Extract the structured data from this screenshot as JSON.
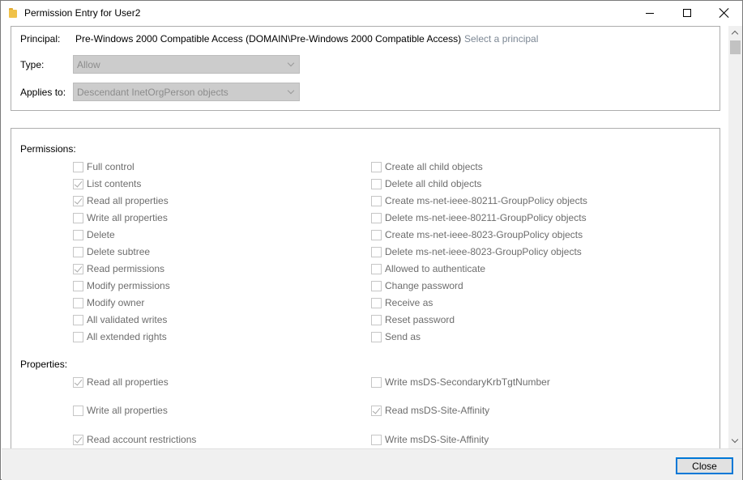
{
  "window": {
    "title": "Permission Entry for User2"
  },
  "principal": {
    "label": "Principal:",
    "value": "Pre-Windows 2000 Compatible Access (DOMAIN\\Pre-Windows 2000 Compatible Access)",
    "select_link": "Select a principal"
  },
  "type": {
    "label": "Type:",
    "value": "Allow"
  },
  "applies_to": {
    "label": "Applies to:",
    "value": "Descendant InetOrgPerson objects"
  },
  "permissions": {
    "title": "Permissions:",
    "left": [
      {
        "label": "Full control",
        "checked": false
      },
      {
        "label": "List contents",
        "checked": true
      },
      {
        "label": "Read all properties",
        "checked": true
      },
      {
        "label": "Write all properties",
        "checked": false
      },
      {
        "label": "Delete",
        "checked": false
      },
      {
        "label": "Delete subtree",
        "checked": false
      },
      {
        "label": "Read permissions",
        "checked": true
      },
      {
        "label": "Modify permissions",
        "checked": false
      },
      {
        "label": "Modify owner",
        "checked": false
      },
      {
        "label": "All validated writes",
        "checked": false
      },
      {
        "label": "All extended rights",
        "checked": false
      }
    ],
    "right": [
      {
        "label": "Create all child objects",
        "checked": false
      },
      {
        "label": "Delete all child objects",
        "checked": false
      },
      {
        "label": "Create ms-net-ieee-80211-GroupPolicy objects",
        "checked": false
      },
      {
        "label": "Delete ms-net-ieee-80211-GroupPolicy objects",
        "checked": false
      },
      {
        "label": "Create ms-net-ieee-8023-GroupPolicy objects",
        "checked": false
      },
      {
        "label": "Delete ms-net-ieee-8023-GroupPolicy objects",
        "checked": false
      },
      {
        "label": "Allowed to authenticate",
        "checked": false
      },
      {
        "label": "Change password",
        "checked": false
      },
      {
        "label": "Receive as",
        "checked": false
      },
      {
        "label": "Reset password",
        "checked": false
      },
      {
        "label": "Send as",
        "checked": false
      }
    ]
  },
  "properties": {
    "title": "Properties:",
    "left": [
      {
        "label": "Read all properties",
        "checked": true
      },
      {
        "label": "Write all properties",
        "checked": false
      },
      {
        "label": "Read account restrictions",
        "checked": true
      }
    ],
    "right": [
      {
        "label": "Write msDS-SecondaryKrbTgtNumber",
        "checked": false
      },
      {
        "label": "Read msDS-Site-Affinity",
        "checked": true
      },
      {
        "label": "Write msDS-Site-Affinity",
        "checked": false
      }
    ]
  },
  "footer": {
    "close_label": "Close"
  },
  "icons": {
    "title": "folder-icon",
    "minimize": "minimize-icon",
    "maximize": "maximize-icon",
    "close": "close-icon",
    "dropdown": "chevron-down-icon"
  }
}
